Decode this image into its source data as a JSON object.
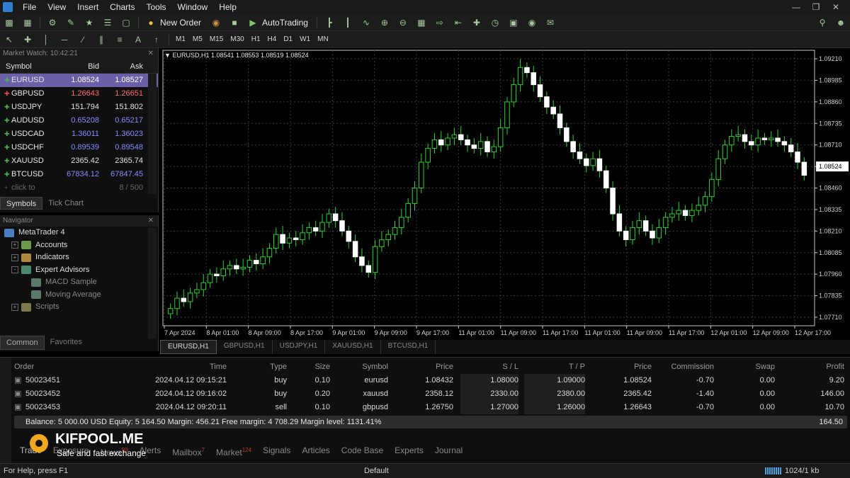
{
  "menu": [
    "File",
    "View",
    "Insert",
    "Charts",
    "Tools",
    "Window",
    "Help"
  ],
  "toolbar": {
    "new_order_label": "New Order",
    "autotrading_label": "AutoTrading",
    "timeframes": [
      "M1",
      "M5",
      "M15",
      "M30",
      "H1",
      "H4",
      "D1",
      "W1",
      "MN"
    ]
  },
  "market_watch": {
    "title": "Market Watch: 10:42:21",
    "headers": {
      "symbol": "Symbol",
      "bid": "Bid",
      "ask": "Ask"
    },
    "rows": [
      {
        "symbol": "EURUSD",
        "bid": "1.08524",
        "ask": "1.08527",
        "dir": "up",
        "bid_color": "#ffffff",
        "ask_color": "#ffffff",
        "selected": true
      },
      {
        "symbol": "GBPUSD",
        "bid": "1.26643",
        "ask": "1.26651",
        "dir": "down",
        "bid_color": "#ff6b6b",
        "ask_color": "#ff6b6b",
        "selected": false
      },
      {
        "symbol": "USDJPY",
        "bid": "151.794",
        "ask": "151.802",
        "dir": "up",
        "bid_color": "#e0e0e0",
        "ask_color": "#e0e0e0",
        "selected": false
      },
      {
        "symbol": "AUDUSD",
        "bid": "0.65208",
        "ask": "0.65217",
        "dir": "up",
        "bid_color": "#8a8aff",
        "ask_color": "#8a8aff",
        "selected": false
      },
      {
        "symbol": "USDCAD",
        "bid": "1.36011",
        "ask": "1.36023",
        "dir": "up",
        "bid_color": "#8a8aff",
        "ask_color": "#8a8aff",
        "selected": false
      },
      {
        "symbol": "USDCHF",
        "bid": "0.89539",
        "ask": "0.89548",
        "dir": "up",
        "bid_color": "#8a8aff",
        "ask_color": "#8a8aff",
        "selected": false
      },
      {
        "symbol": "XAUUSD",
        "bid": "2365.42",
        "ask": "2365.74",
        "dir": "up",
        "bid_color": "#e0e0e0",
        "ask_color": "#e0e0e0",
        "selected": false
      },
      {
        "symbol": "BTCUSD",
        "bid": "67834.12",
        "ask": "67847.45",
        "dir": "up",
        "bid_color": "#8a8aff",
        "ask_color": "#8a8aff",
        "selected": false
      }
    ],
    "add_label": "click to add...",
    "count": "8 / 500",
    "tabs": [
      "Symbols",
      "Tick Chart"
    ]
  },
  "navigator": {
    "title": "Navigator",
    "items": [
      {
        "label": "MetaTrader 4",
        "level": 0,
        "expander": "",
        "color": "#4a7fc0"
      },
      {
        "label": "Accounts",
        "level": 1,
        "expander": "+",
        "color": "#6a9a4a"
      },
      {
        "label": "Indicators",
        "level": 1,
        "expander": "+",
        "color": "#b08a3a"
      },
      {
        "label": "Expert Advisors",
        "level": 1,
        "expander": "-",
        "color": "#4a8a6a"
      },
      {
        "label": "MACD Sample",
        "level": 2,
        "expander": "",
        "color": "#5a7a6a"
      },
      {
        "label": "Moving Average",
        "level": 2,
        "expander": "",
        "color": "#5a7a6a"
      },
      {
        "label": "Scripts",
        "level": 1,
        "expander": "+",
        "color": "#7a7a4a"
      }
    ],
    "tabs": [
      "Common",
      "Favorites"
    ]
  },
  "chart_data": {
    "type": "candlestick",
    "title": "EURUSD,H1  1.08541 1.08553 1.08519 1.08524",
    "current_price": "1.08524",
    "ylim": [
      1.0765,
      1.0925
    ],
    "y_ticks": [
      "1.09210",
      "1.08985",
      "1.08860",
      "1.08735",
      "1.08710",
      "1.08524",
      "1.08460",
      "1.08335",
      "1.08210",
      "1.08085",
      "1.07960",
      "1.07835",
      "1.07710"
    ],
    "x_ticks": [
      "7 Apr 2024",
      "8 Apr 01:00",
      "8 Apr 09:00",
      "8 Apr 17:00",
      "9 Apr 01:00",
      "9 Apr 09:00",
      "9 Apr 17:00",
      "11 Apr 01:00",
      "11 Apr 09:00",
      "11 Apr 17:00",
      "11 Apr 01:00",
      "11 Apr 09:00",
      "11 Apr 17:00",
      "12 Apr 01:00",
      "12 Apr 09:00",
      "12 Apr 17:00"
    ],
    "closes": [
      1.0775,
      1.0781,
      1.0779,
      1.0784,
      1.0786,
      1.079,
      1.0795,
      1.0794,
      1.0798,
      1.08,
      1.0798,
      1.0799,
      1.0803,
      1.0801,
      1.0805,
      1.081,
      1.0818,
      1.0813,
      1.0816,
      1.0815,
      1.0819,
      1.0822,
      1.082,
      1.0825,
      1.083,
      1.0826,
      1.082,
      1.0814,
      1.0805,
      1.08,
      1.0796,
      1.0811,
      1.0815,
      1.0818,
      1.0822,
      1.0828,
      1.0836,
      1.0845,
      1.086,
      1.0868,
      1.0873,
      1.087,
      1.0874,
      1.0876,
      1.0873,
      1.087,
      1.0868,
      1.0872,
      1.0866,
      1.0869,
      1.088,
      1.0895,
      1.0905,
      1.0915,
      1.0912,
      1.0905,
      1.0898,
      1.0892,
      1.0888,
      1.088,
      1.0872,
      1.0866,
      1.0862,
      1.0858,
      1.0862,
      1.0855,
      1.0845,
      1.083,
      1.082,
      1.0815,
      1.0822,
      1.0826,
      1.082,
      1.0816,
      1.0822,
      1.0828,
      1.083,
      1.0832,
      1.0829,
      1.0832,
      1.0835,
      1.084,
      1.085,
      1.0862,
      1.087,
      1.0875,
      1.0876,
      1.0872,
      1.087,
      1.0874,
      1.0873,
      1.0874,
      1.0872,
      1.087,
      1.0866,
      1.086,
      1.08524
    ]
  },
  "chart_tabs": [
    "EURUSD,H1",
    "GBPUSD,H1",
    "USDJPY,H1",
    "XAUUSD,H1",
    "BTCUSD,H1"
  ],
  "terminal": {
    "headers": [
      "Order",
      "Time",
      "Type",
      "Size",
      "Symbol",
      "Price",
      "S / L",
      "T / P",
      "Price",
      "Commission",
      "Swap",
      "Profit"
    ],
    "rows": [
      [
        "50023451",
        "2024.04.12 09:15:21",
        "buy",
        "0.10",
        "eurusd",
        "1.08432",
        "1.08000",
        "1.09000",
        "1.08524",
        "-0.70",
        "0.00",
        "9.20"
      ],
      [
        "50023452",
        "2024.04.12 09:16:02",
        "buy",
        "0.20",
        "xauusd",
        "2358.12",
        "2330.00",
        "2380.00",
        "2365.42",
        "-1.40",
        "0.00",
        "146.00"
      ],
      [
        "50023453",
        "2024.04.12 09:20:11",
        "sell",
        "0.10",
        "gbpusd",
        "1.26750",
        "1.27000",
        "1.26000",
        "1.26643",
        "-0.70",
        "0.00",
        "10.70"
      ]
    ],
    "balance_line": "Balance: 5 000.00 USD  Equity: 5 164.50  Margin: 456.21  Free margin: 4 708.29  Margin level: 1131.41%",
    "total_profit": "164.50",
    "tabs": [
      {
        "label": "Trade",
        "badge": ""
      },
      {
        "label": "Exposure",
        "badge": ""
      },
      {
        "label": "News",
        "badge": "99"
      },
      {
        "label": "Alerts",
        "badge": ""
      },
      {
        "label": "Mailbox",
        "badge": "7"
      },
      {
        "label": "Market",
        "badge": "124"
      },
      {
        "label": "Signals",
        "badge": ""
      },
      {
        "label": "Articles",
        "badge": ""
      },
      {
        "label": "Code Base",
        "badge": ""
      },
      {
        "label": "Experts",
        "badge": ""
      },
      {
        "label": "Journal",
        "badge": ""
      }
    ]
  },
  "statusbar": {
    "help": "For Help, press F1",
    "profile": "Default",
    "traffic": "1024/1 kb"
  },
  "watermark": {
    "brand": "KIFPOOL.ME",
    "tagline": "Safe and fast exchange"
  }
}
